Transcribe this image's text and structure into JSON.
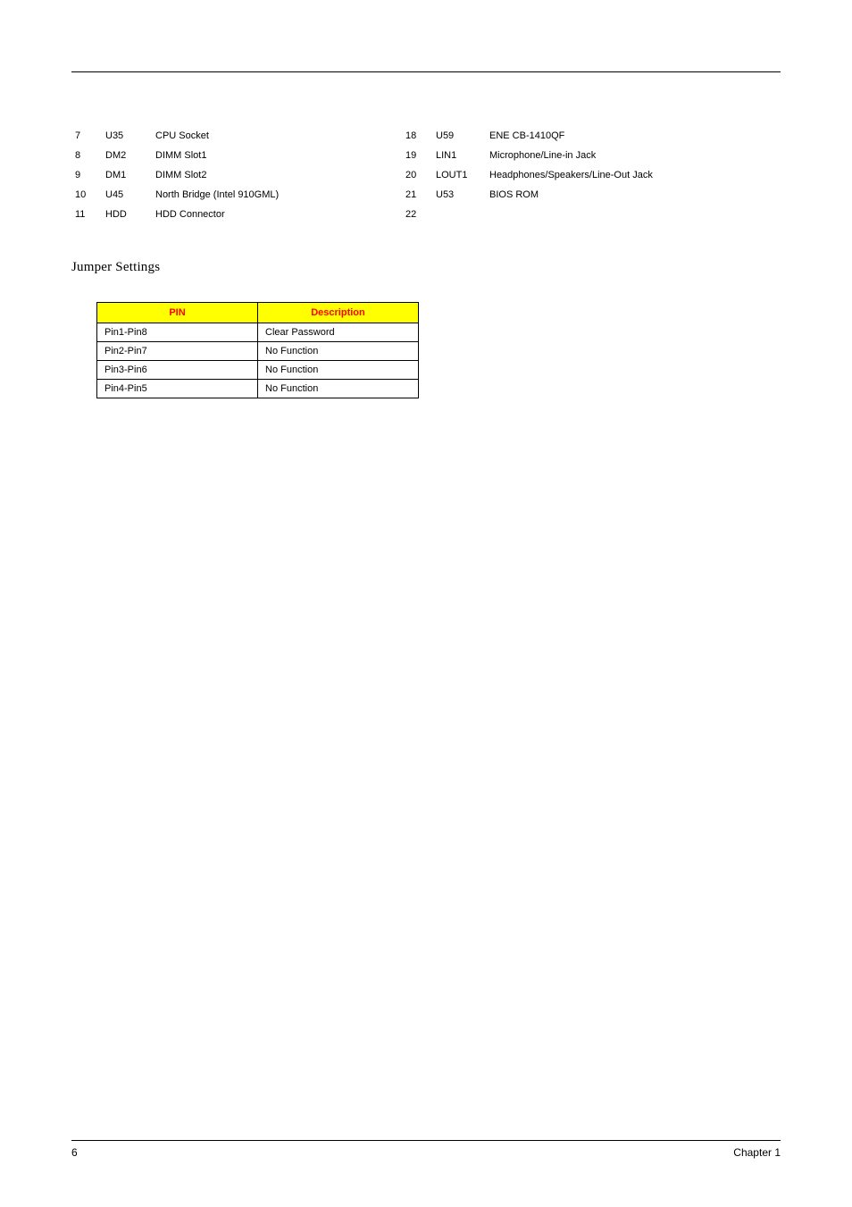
{
  "components": {
    "left": [
      {
        "num": "7",
        "id": "U35",
        "desc": "CPU Socket"
      },
      {
        "num": "8",
        "id": "DM2",
        "desc": "DIMM Slot1"
      },
      {
        "num": "9",
        "id": "DM1",
        "desc": "DIMM Slot2"
      },
      {
        "num": "10",
        "id": "U45",
        "desc": "North Bridge (Intel 910GML)"
      },
      {
        "num": "11",
        "id": "HDD",
        "desc": "HDD Connector"
      }
    ],
    "right": [
      {
        "num": "18",
        "id": "U59",
        "desc": "ENE CB-1410QF"
      },
      {
        "num": "19",
        "id": "LIN1",
        "desc": "Microphone/Line-in Jack"
      },
      {
        "num": "20",
        "id": "LOUT1",
        "desc": "Headphones/Speakers/Line-Out Jack"
      },
      {
        "num": "21",
        "id": "U53",
        "desc": "BIOS ROM"
      },
      {
        "num": "22",
        "id": "",
        "desc": ""
      }
    ]
  },
  "jumper": {
    "heading": "Jumper Settings",
    "headers": {
      "pin": "PIN",
      "desc": "Description"
    },
    "rows": [
      {
        "pin": "Pin1-Pin8",
        "desc": "Clear Password"
      },
      {
        "pin": "Pin2-Pin7",
        "desc": "No Function"
      },
      {
        "pin": "Pin3-Pin6",
        "desc": "No Function"
      },
      {
        "pin": "Pin4-Pin5",
        "desc": "No Function"
      }
    ]
  },
  "footer": {
    "page": "6",
    "chapter": "Chapter 1"
  }
}
